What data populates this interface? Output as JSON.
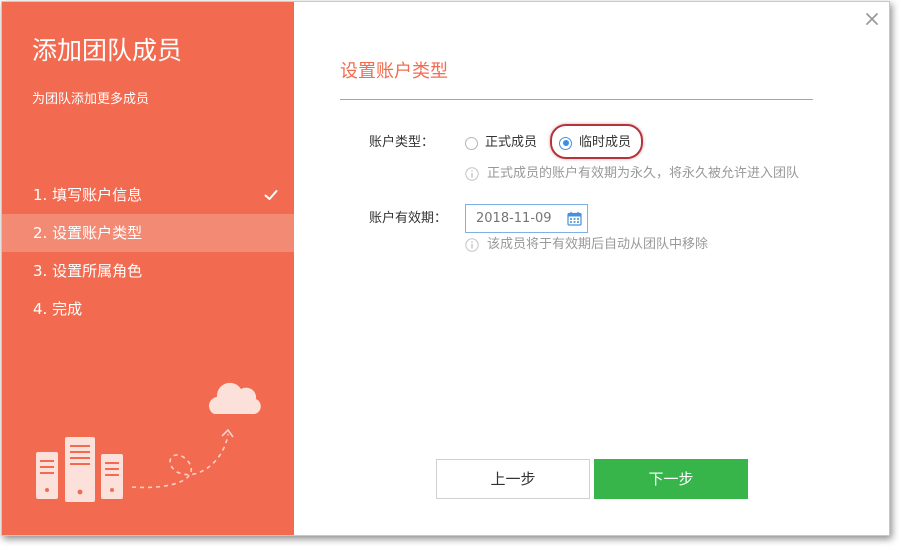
{
  "dialog": {
    "sidebar": {
      "title": "添加团队成员",
      "subtitle": "为团队添加更多成员",
      "steps": [
        {
          "label": "1. 填写账户信息",
          "state": "done"
        },
        {
          "label": "2. 设置账户类型",
          "state": "active"
        },
        {
          "label": "3. 设置所属角色",
          "state": "pending"
        },
        {
          "label": "4. 完成",
          "state": "pending"
        }
      ],
      "illustration_icons": [
        "server-icon",
        "cloud-icon",
        "dashed-arrow-icon"
      ]
    },
    "section_title": "设置账户类型",
    "form": {
      "account_type_label": "账户类型：",
      "options": [
        {
          "label": "正式成员",
          "checked": false
        },
        {
          "label": "临时成员",
          "checked": true
        }
      ],
      "account_type_hint": "正式成员的账户有效期为永久，将永久被允许进入团队",
      "expire_label": "账户有效期：",
      "expire_value": "2018-11-09",
      "expire_hint": "该成员将于有效期后自动从团队中移除"
    },
    "buttons": {
      "prev": "上一步",
      "next": "下一步"
    },
    "colors": {
      "sidebar_bg": "#f26b51",
      "active_step_bg": "#f38a74",
      "accent": "#f26b51",
      "primary_button": "#38b54a",
      "radio_checked": "#3a8ee6",
      "highlight_ring": "#b4343a"
    }
  }
}
